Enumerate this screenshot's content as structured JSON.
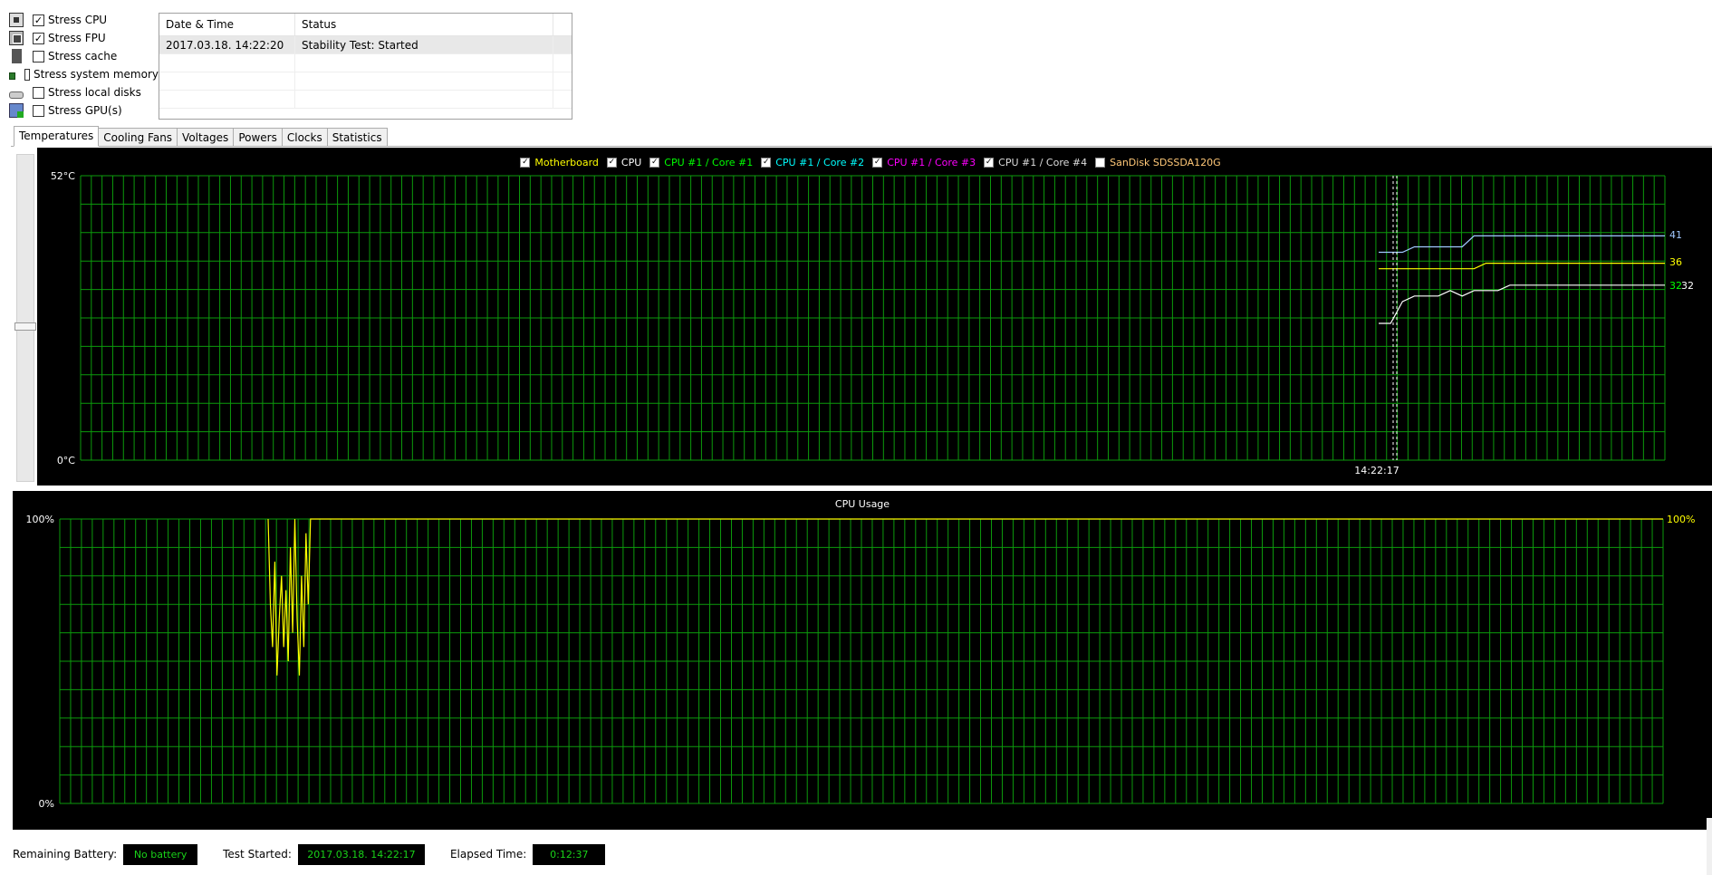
{
  "stress_options": [
    {
      "label": "Stress CPU",
      "checked": true,
      "icon": "cpu-chip-icon"
    },
    {
      "label": "Stress FPU",
      "checked": true,
      "icon": "fpu-chip-icon"
    },
    {
      "label": "Stress cache",
      "checked": false,
      "icon": "cache-icon"
    },
    {
      "label": "Stress system memory",
      "checked": false,
      "icon": "memory-module-icon"
    },
    {
      "label": "Stress local disks",
      "checked": false,
      "icon": "hard-disk-icon"
    },
    {
      "label": "Stress GPU(s)",
      "checked": false,
      "icon": "gpu-card-icon"
    }
  ],
  "log": {
    "columns": [
      "Date & Time",
      "Status"
    ],
    "rows": [
      {
        "datetime": "2017.03.18. 14:22:20",
        "status": "Stability Test: Started"
      }
    ]
  },
  "tabs": [
    "Temperatures",
    "Cooling Fans",
    "Voltages",
    "Powers",
    "Clocks",
    "Statistics"
  ],
  "active_tab": "Temperatures",
  "temperature_chart": {
    "legend": [
      {
        "name": "Motherboard",
        "checked": true,
        "color": "#ffff00"
      },
      {
        "name": "CPU",
        "checked": true,
        "color": "#ffffff"
      },
      {
        "name": "CPU #1 / Core #1",
        "checked": true,
        "color": "#00ff00"
      },
      {
        "name": "CPU #1 / Core #2",
        "checked": true,
        "color": "#00ffff"
      },
      {
        "name": "CPU #1 / Core #3",
        "checked": true,
        "color": "#ff00ff"
      },
      {
        "name": "CPU #1 / Core #4",
        "checked": true,
        "color": "#dddddd"
      },
      {
        "name": "SanDisk SDSSDA120G",
        "checked": false,
        "color": "#ffc878"
      }
    ],
    "y_max_label": "52°C",
    "y_min_label": "0°C",
    "time_label": "14:22:17",
    "value_labels": [
      {
        "text": "41",
        "color": "#a0c8ff"
      },
      {
        "text": "36",
        "color": "#ffff00"
      },
      {
        "text": "32",
        "color": "#00ff00"
      },
      {
        "text": "32",
        "color": "#ffffff"
      }
    ]
  },
  "cpu_chart": {
    "title": "CPU Usage",
    "y_max_label": "100%",
    "y_min_label": "0%",
    "current_label": "100%"
  },
  "chart_data": [
    {
      "type": "line",
      "ylabel": "",
      "ylim": [
        0,
        52
      ],
      "yunit": "°C",
      "grid": true,
      "legend_position": "top-center",
      "series": [
        {
          "name": "CPU",
          "color": "#a0c8ff",
          "values": [
            38,
            38,
            38,
            39,
            39,
            39,
            39,
            39,
            41,
            41,
            41,
            41,
            41,
            41,
            41,
            41,
            41,
            41,
            41,
            41,
            41,
            41,
            41,
            41,
            41
          ]
        },
        {
          "name": "Motherboard",
          "color": "#ffff00",
          "values": [
            35,
            35,
            35,
            35,
            35,
            35,
            35,
            35,
            35,
            36,
            36,
            36,
            36,
            36,
            36,
            36,
            36,
            36,
            36,
            36,
            36,
            36,
            36,
            36,
            36
          ]
        },
        {
          "name": "CPU #1 / Core #1",
          "color": "#ffffff",
          "values": [
            25,
            25,
            29,
            30,
            30,
            30,
            31,
            30,
            31,
            31,
            31,
            32,
            32,
            32,
            32,
            32,
            32,
            32,
            32,
            32,
            32,
            32,
            32,
            32,
            32
          ]
        }
      ]
    },
    {
      "type": "line",
      "title": "CPU Usage",
      "ylim": [
        0,
        100
      ],
      "yunit": "%",
      "grid": true,
      "series": [
        {
          "name": "CPU Usage",
          "color": "#ffff00",
          "values": [
            100,
            70,
            55,
            85,
            45,
            65,
            80,
            55,
            75,
            50,
            90,
            60,
            100,
            65,
            45,
            80,
            55,
            95,
            70,
            100,
            100,
            100,
            100,
            100,
            100,
            100,
            100,
            100,
            100,
            100,
            100,
            100,
            100,
            100,
            100,
            100,
            100,
            100,
            100,
            100
          ]
        }
      ]
    }
  ],
  "status_bar": {
    "battery_label": "Remaining Battery:",
    "battery_value": "No battery",
    "started_label": "Test Started:",
    "started_value": "2017.03.18. 14:22:17",
    "elapsed_label": "Elapsed Time:",
    "elapsed_value": "0:12:37"
  }
}
